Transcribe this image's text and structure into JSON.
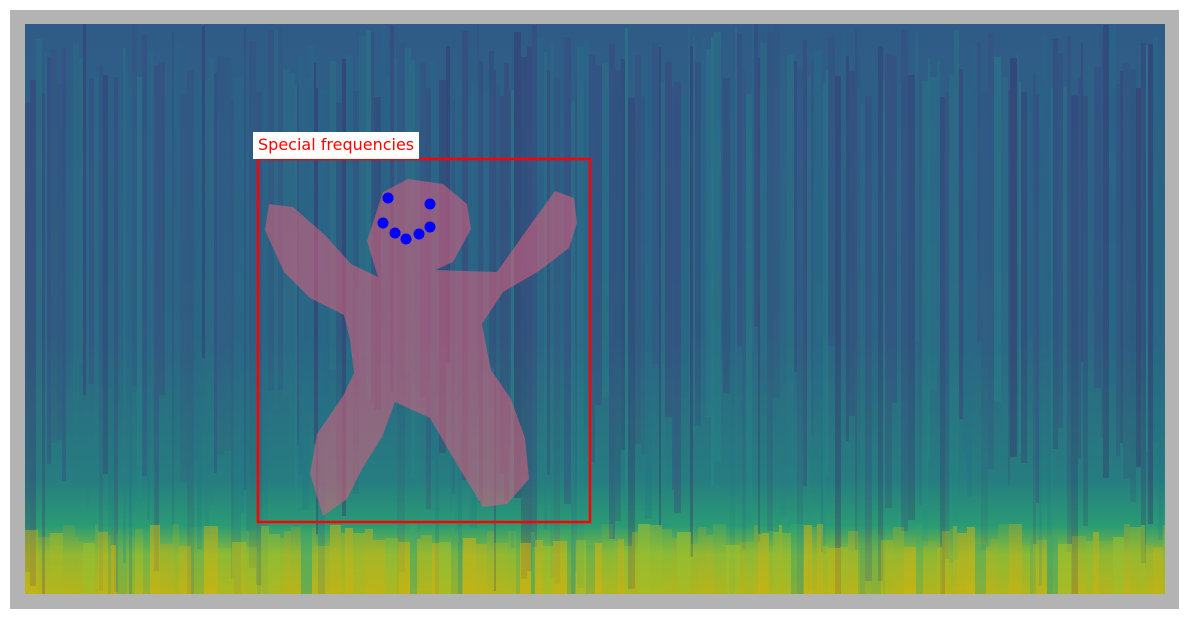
{
  "chart_data": {
    "type": "heatmap",
    "colormap": "viridis",
    "xlabel": "",
    "ylabel": "",
    "grid": false,
    "annotations": [
      {
        "type": "rectangle",
        "text": "Special frequencies",
        "color": "#ff0000"
      },
      {
        "type": "polygon",
        "shape": "stick-figure",
        "color": "#e0607e",
        "opacity": 0.55
      },
      {
        "type": "points",
        "shape": "smiley-face",
        "color": "#0000ff",
        "count": 7
      }
    ]
  },
  "colors": {
    "frame": "#b3b3b3",
    "box": "#ff0000",
    "label_text": "#ff0000",
    "figure_fill": "#e0607e",
    "face_dots": "#0000ff"
  }
}
